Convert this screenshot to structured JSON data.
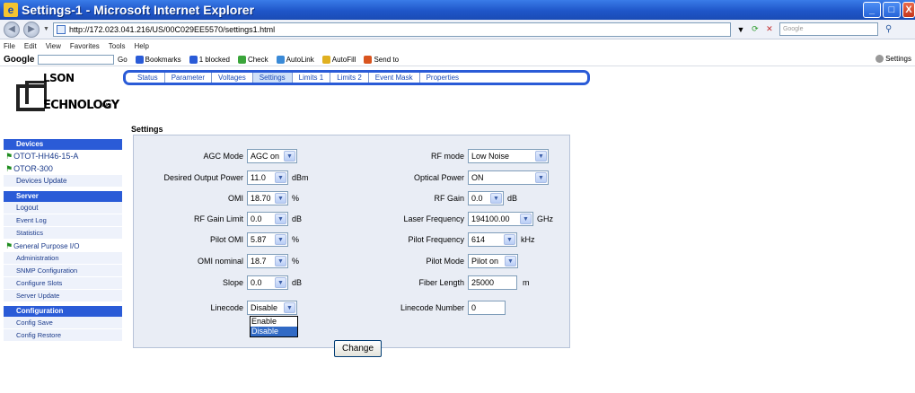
{
  "window": {
    "title": "Settings-1 - Microsoft Internet Explorer",
    "minimize": "_",
    "maximize": "□",
    "close": "X"
  },
  "address": {
    "url": "http://172.023.041.216/US/00C029EE5570/settings1.html",
    "search_placeholder": "Google"
  },
  "menu": [
    "File",
    "Edit",
    "View",
    "Favorites",
    "Tools",
    "Help"
  ],
  "google_toolbar": {
    "logo": "Google",
    "go": "Go",
    "bookmarks": "Bookmarks",
    "blocked": "1 blocked",
    "check": "Check",
    "autolink": "AutoLink",
    "autofill": "AutoFill",
    "sendto": "Send to",
    "settings": "Settings"
  },
  "logo": {
    "line1": "LSON",
    "line2": "ECHNOLOGY",
    "suffix": "INC"
  },
  "tabs": [
    "Status",
    "Parameter",
    "Voltages",
    "Settings",
    "Limits 1",
    "Limits 2",
    "Event Mask",
    "Properties"
  ],
  "active_tab": "Settings",
  "page_title": "Settings",
  "sidebar": {
    "devices_header": "Devices",
    "devices": [
      "OTOT-HH46-15-A",
      "OTOR-300"
    ],
    "devices_update": "Devices Update",
    "server_header": "Server",
    "server_items": [
      "Logout",
      "Event Log",
      "Statistics"
    ],
    "gpio": "General Purpose I/O",
    "admin_items": [
      "Administration",
      "SNMP Configuration",
      "Configure Slots",
      "Server Update"
    ],
    "config_header": "Configuration",
    "config_items": [
      "Config Save",
      "Config Restore"
    ]
  },
  "settings_left": [
    {
      "label": "AGC Mode",
      "value": "AGC on",
      "unit": ""
    },
    {
      "label": "Desired Output Power",
      "value": "11.0",
      "unit": "dBm"
    },
    {
      "label": "OMI",
      "value": "18.70",
      "unit": "%"
    },
    {
      "label": "RF Gain Limit",
      "value": "0.0",
      "unit": "dB"
    },
    {
      "label": "Pilot OMI",
      "value": "5.87",
      "unit": "%"
    },
    {
      "label": "OMI nominal",
      "value": "18.7",
      "unit": "%"
    },
    {
      "label": "Slope",
      "value": "0.0",
      "unit": "dB"
    },
    {
      "label": "Linecode",
      "value": "Disable",
      "unit": ""
    }
  ],
  "settings_right": [
    {
      "label": "RF mode",
      "value": "Low Noise",
      "unit": ""
    },
    {
      "label": "Optical Power",
      "value": "ON",
      "unit": ""
    },
    {
      "label": "RF Gain",
      "value": "0.0",
      "unit": "dB"
    },
    {
      "label": "Laser Frequency",
      "value": "194100.00",
      "unit": "GHz"
    },
    {
      "label": "Pilot Frequency",
      "value": "614",
      "unit": "kHz"
    },
    {
      "label": "Pilot Mode",
      "value": "Pilot on",
      "unit": ""
    },
    {
      "label": "Fiber Length",
      "value": "25000",
      "unit": "m"
    },
    {
      "label": "Linecode Number",
      "value": "0",
      "unit": ""
    }
  ],
  "linecode_dropdown": {
    "options": [
      "Enable",
      "Disable"
    ],
    "highlighted": "Disable"
  },
  "change_button": "Change"
}
